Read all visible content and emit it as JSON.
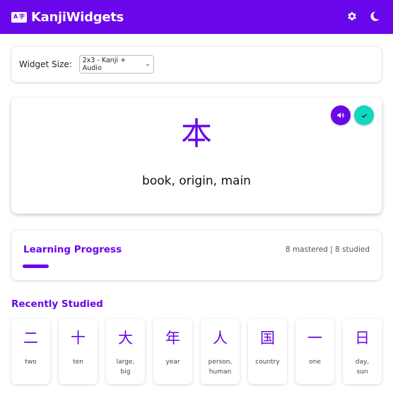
{
  "app": {
    "title": "KanjiWidgets",
    "logo_text_left": "A",
    "logo_text_right": "字",
    "colors": {
      "primary": "#6a06ea",
      "accent": "#11d6c0"
    }
  },
  "header": {
    "settings_icon": "gear-icon",
    "theme_icon": "moon-icon"
  },
  "widget_size": {
    "label": "Widget Size:",
    "selected": "2x3 - Kanji + Audio"
  },
  "current_kanji": {
    "character": "本",
    "meaning": "book, origin, main",
    "audio_icon": "speaker-icon",
    "check_icon": "check-icon"
  },
  "progress": {
    "title": "Learning Progress",
    "stats": "8 mastered | 8 studied",
    "fraction": 0.076
  },
  "recent": {
    "title": "Recently Studied",
    "items": [
      {
        "kanji": "二",
        "meaning": "two"
      },
      {
        "kanji": "十",
        "meaning": "ten"
      },
      {
        "kanji": "大",
        "meaning": "large,\nbig"
      },
      {
        "kanji": "年",
        "meaning": "year"
      },
      {
        "kanji": "人",
        "meaning": "person,\nhuman"
      },
      {
        "kanji": "国",
        "meaning": "country"
      },
      {
        "kanji": "一",
        "meaning": "one"
      },
      {
        "kanji": "日",
        "meaning": "day,\nsun"
      }
    ]
  }
}
